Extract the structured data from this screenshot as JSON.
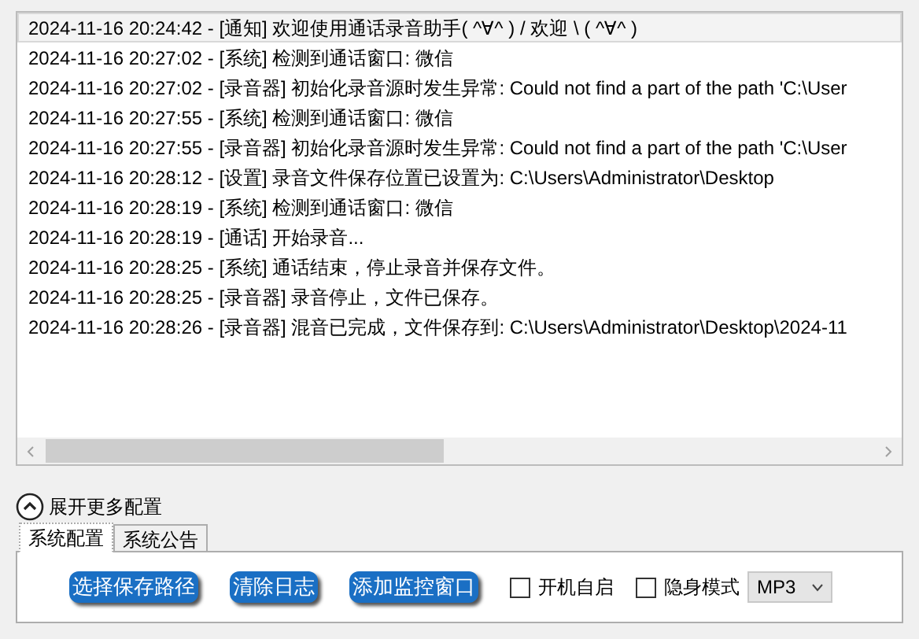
{
  "log": {
    "rows": [
      {
        "text": "2024-11-16 20:24:42 - [通知] 欢迎使用通话录音助手( ^∀^ )  / 欢迎 \\ ( ^∀^ )",
        "selected": true
      },
      {
        "text": "2024-11-16 20:27:02 - [系统] 检测到通话窗口: 微信",
        "selected": false
      },
      {
        "text": "2024-11-16 20:27:02 - [录音器] 初始化录音源时发生异常: Could not find a part of the path 'C:\\User",
        "selected": false
      },
      {
        "text": "2024-11-16 20:27:55 - [系统] 检测到通话窗口: 微信",
        "selected": false
      },
      {
        "text": "2024-11-16 20:27:55 - [录音器] 初始化录音源时发生异常: Could not find a part of the path 'C:\\User",
        "selected": false
      },
      {
        "text": "2024-11-16 20:28:12 - [设置] 录音文件保存位置已设置为: C:\\Users\\Administrator\\Desktop",
        "selected": false
      },
      {
        "text": "2024-11-16 20:28:19 - [系统] 检测到通话窗口: 微信",
        "selected": false
      },
      {
        "text": "2024-11-16 20:28:19 - [通话] 开始录音...",
        "selected": false
      },
      {
        "text": "2024-11-16 20:28:25 - [系统] 通话结束，停止录音并保存文件。",
        "selected": false
      },
      {
        "text": "2024-11-16 20:28:25 - [录音器] 录音停止，文件已保存。",
        "selected": false
      },
      {
        "text": "2024-11-16 20:28:26 - [录音器] 混音已完成，文件保存到: C:\\Users\\Administrator\\Desktop\\2024-11",
        "selected": false
      }
    ]
  },
  "more_config": {
    "label": "展开更多配置",
    "expanded": true
  },
  "tabs": [
    {
      "label": "系统配置",
      "selected": true
    },
    {
      "label": "系统公告",
      "selected": false
    }
  ],
  "buttons": [
    "选择保存路径",
    "清除日志",
    "添加监控窗口"
  ],
  "checkboxes": [
    {
      "label": "开机自启",
      "checked": false
    },
    {
      "label": "隐身模式",
      "checked": false
    }
  ],
  "format_select": {
    "value": "MP3"
  }
}
